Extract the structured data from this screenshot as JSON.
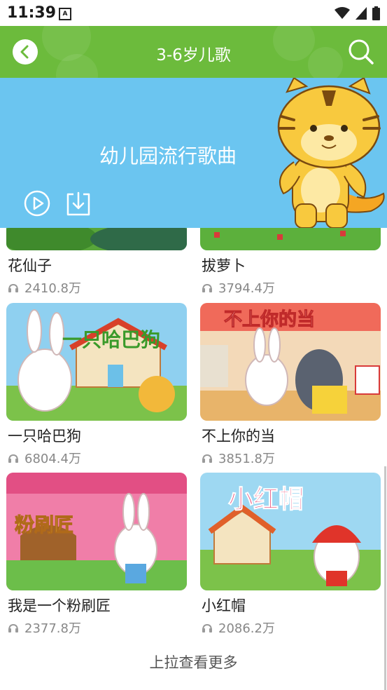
{
  "status_bar": {
    "time": "11:39",
    "badge": "A"
  },
  "app_bar": {
    "title": "3-6岁儿歌",
    "bg_color": "#6cbb3c"
  },
  "banner": {
    "subtitle": "幼儿园流行歌曲",
    "bg_color": "#6bc5f0"
  },
  "songs": [
    {
      "title": "花仙子",
      "plays": "2410.8万"
    },
    {
      "title": "拔萝卜",
      "plays": "3794.4万"
    },
    {
      "title": "一只哈巴狗",
      "plays": "6804.4万",
      "thumb_text": "一只哈巴狗"
    },
    {
      "title": "不上你的当",
      "plays": "3851.8万",
      "thumb_text": "不上你的当"
    },
    {
      "title": "我是一个粉刷匠",
      "plays": "2377.8万",
      "thumb_text": "粉刷匠"
    },
    {
      "title": "小红帽",
      "plays": "2086.2万",
      "thumb_text": "小红帽"
    }
  ],
  "footer": {
    "load_more": "上拉查看更多"
  }
}
